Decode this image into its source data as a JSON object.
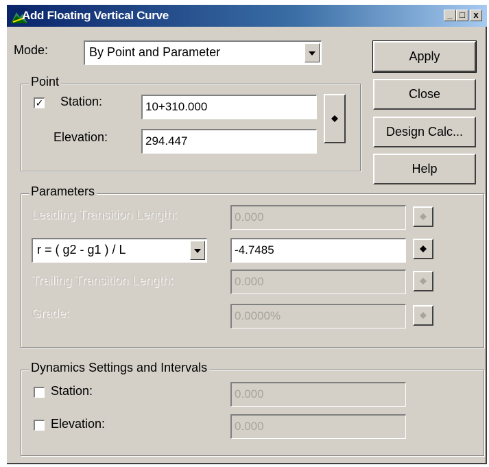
{
  "window": {
    "title": "Add Floating Vertical Curve",
    "controls": [
      "_",
      "□",
      "x"
    ]
  },
  "mode": {
    "label": "Mode:",
    "value": "By Point and Parameter"
  },
  "buttons": {
    "apply": "Apply",
    "close": "Close",
    "design_calc": "Design Calc...",
    "help": "Help"
  },
  "point": {
    "group_label": "Point",
    "station_label": "Station:",
    "station_value": "10+310.000",
    "station_checked": true,
    "elevation_label": "Elevation:",
    "elevation_value": "294.447"
  },
  "parameters": {
    "group_label": "Parameters",
    "leading_label": "Leading Transition Length:",
    "leading_value": "0.000",
    "formula_value": "r = ( g2 - g1 ) / L",
    "formula_result": "-4.7485",
    "trailing_label": "Trailing Transition Length:",
    "trailing_value": "0.000",
    "grade_label": "Grade:",
    "grade_value": "0.0000%"
  },
  "dynamics": {
    "group_label": "Dynamics Settings and Intervals",
    "station_label": "Station:",
    "station_value": "0.000",
    "station_checked": false,
    "elevation_label": "Elevation:",
    "elevation_value": "0.000",
    "elevation_checked": false
  },
  "colors": {
    "titlebar_start": "#0a246a",
    "titlebar_end": "#a6caf0",
    "face": "#d4d0c8"
  },
  "icons": {
    "app": "mountain-road-icon",
    "pick": "target-dot-icon"
  }
}
